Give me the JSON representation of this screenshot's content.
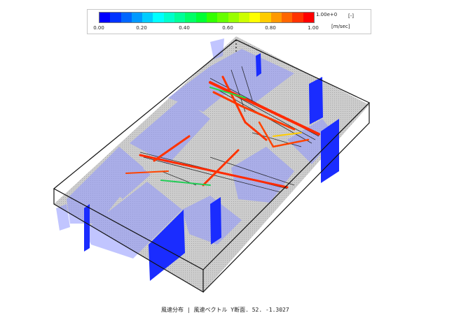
{
  "legend": {
    "ticks": [
      "0.00",
      "0.20",
      "0.40",
      "0.60",
      "0.80",
      "1.00"
    ],
    "scale": "1.00e+0",
    "dimensionless": "[-]",
    "unit": "[m/sec]",
    "colors": [
      "#0000ff",
      "#0033ff",
      "#0066ff",
      "#0099ff",
      "#00ccff",
      "#00ffff",
      "#00ffcc",
      "#00ff99",
      "#00ff66",
      "#00ff33",
      "#33ff00",
      "#66ff00",
      "#99ff00",
      "#ccff00",
      "#ffff00",
      "#ffcc00",
      "#ff9900",
      "#ff6600",
      "#ff3300",
      "#ff0000"
    ]
  },
  "caption": "風速分布 | 風速ベクトル Y断面. 52. -1.3027",
  "scene_colors": {
    "floor": "#bdbdbd",
    "isosurface": "#8f96ff",
    "plane_low": "#1a2cff",
    "jet": "#ff2a00"
  }
}
